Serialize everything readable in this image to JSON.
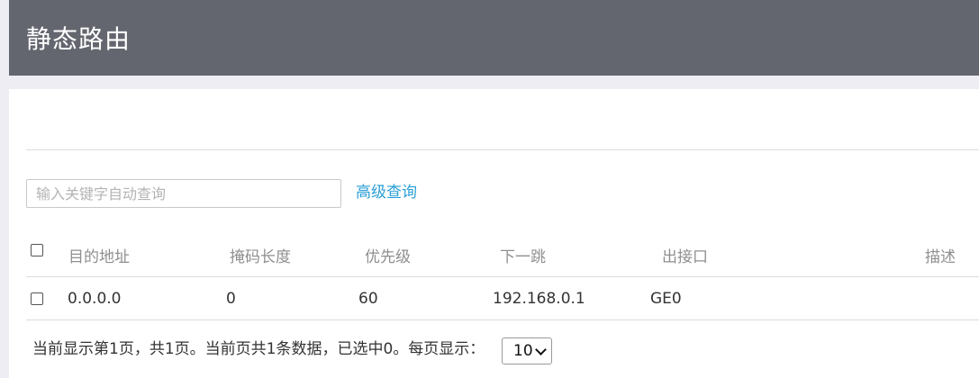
{
  "header": {
    "title": "静态路由"
  },
  "search": {
    "placeholder": "输入关键字自动查询",
    "value": ""
  },
  "advanced_search_label": "高级查询",
  "table": {
    "columns": [
      "目的地址",
      "掩码长度",
      "优先级",
      "下一跳",
      "出接口",
      "描述"
    ],
    "rows": [
      {
        "checked": false,
        "cells": [
          "0.0.0.0",
          "0",
          "60",
          "192.168.0.1",
          "GE0",
          ""
        ]
      }
    ]
  },
  "footer": {
    "status_text": "当前显示第1页，共1页。当前页共1条数据，已选中0。每页显示：",
    "page_size": "10"
  }
}
